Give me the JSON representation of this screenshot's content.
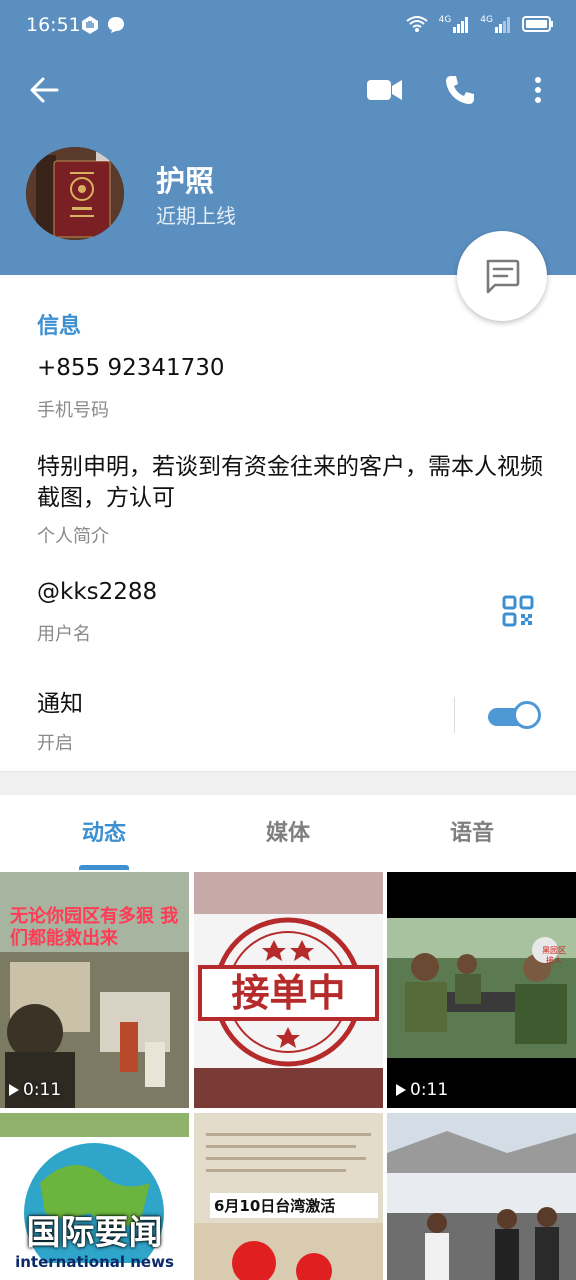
{
  "status_bar": {
    "time": "16:51",
    "network_1": "4G",
    "network_2": "4G"
  },
  "header": {
    "title": "护照",
    "subtitle": "近期上线"
  },
  "info": {
    "section_title": "信息",
    "phone_value": "+855 92341730",
    "phone_label": "手机号码",
    "bio_value": "特别申明，若谈到有资金往来的客户，需本人视频截图，方认可",
    "bio_label": "个人简介",
    "username_value": "@kks2288",
    "username_label": "用户名",
    "notify_value": "通知",
    "notify_label": "开启",
    "notify_on": true
  },
  "tabs": [
    {
      "label": "动态",
      "active": true
    },
    {
      "label": "媒体",
      "active": false
    },
    {
      "label": "语音",
      "active": false
    }
  ],
  "media": [
    {
      "duration": "0:11",
      "overlay": "无论你园区有多狠 我们都能救出来"
    },
    {
      "stamp": "接单中"
    },
    {
      "duration": "0:11",
      "overlay": "黑园区 接人"
    },
    {
      "overlay": "国际要闻",
      "overlay_sub": "international news"
    },
    {
      "overlay": "6月10日台湾激活"
    },
    {}
  ],
  "colors": {
    "header": "#5b8fc0",
    "accent": "#3c8fd0"
  }
}
